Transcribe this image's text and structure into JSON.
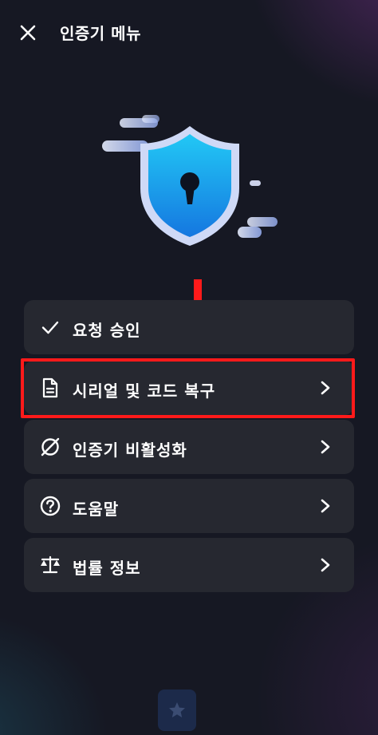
{
  "header": {
    "title": "인증기 메뉴"
  },
  "menu": [
    {
      "label": "요청 승인",
      "icon": "checkmark-icon",
      "has_chevron": false
    },
    {
      "label": "시리얼 및 코드 복구",
      "icon": "document-icon",
      "has_chevron": true,
      "highlighted": true
    },
    {
      "label": "인증기 비활성화",
      "icon": "disable-circle-icon",
      "has_chevron": true
    },
    {
      "label": "도움말",
      "icon": "help-circle-icon",
      "has_chevron": true
    },
    {
      "label": "법률 정보",
      "icon": "scales-icon",
      "has_chevron": true
    }
  ],
  "colors": {
    "background": "#161823",
    "card": "#262830",
    "highlight": "#ff1a1a",
    "shield": "#1aa8ee"
  },
  "bottom_nav": {
    "icon": "star-icon"
  }
}
